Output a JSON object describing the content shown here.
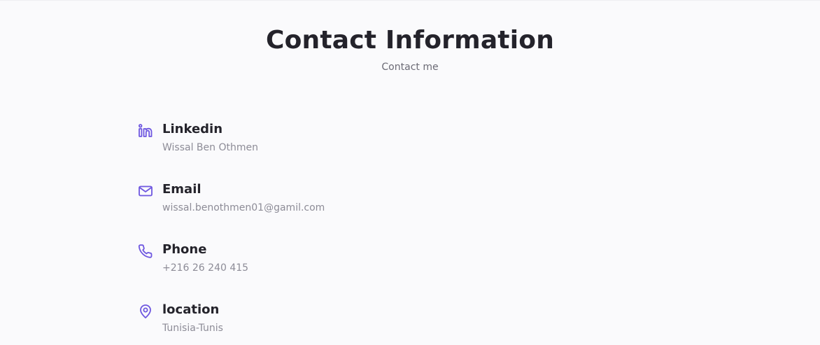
{
  "header": {
    "title": "Contact Information",
    "subtitle": "Contact me"
  },
  "contacts": [
    {
      "icon": "linkedin-icon",
      "label": "Linkedin",
      "value": "Wissal Ben Othmen"
    },
    {
      "icon": "mail-icon",
      "label": "Email",
      "value": "wissal.benothmen01@gamil.com"
    },
    {
      "icon": "phone-icon",
      "label": "Phone",
      "value": "+216 26 240 415"
    },
    {
      "icon": "map-pin-icon",
      "label": "location",
      "value": "Tunisia-Tunis"
    }
  ],
  "colors": {
    "accent": "#6e57e0",
    "title": "#24232b",
    "subtitle": "#6b6a75",
    "value_text": "#8d8c97",
    "background": "#fafafc"
  }
}
